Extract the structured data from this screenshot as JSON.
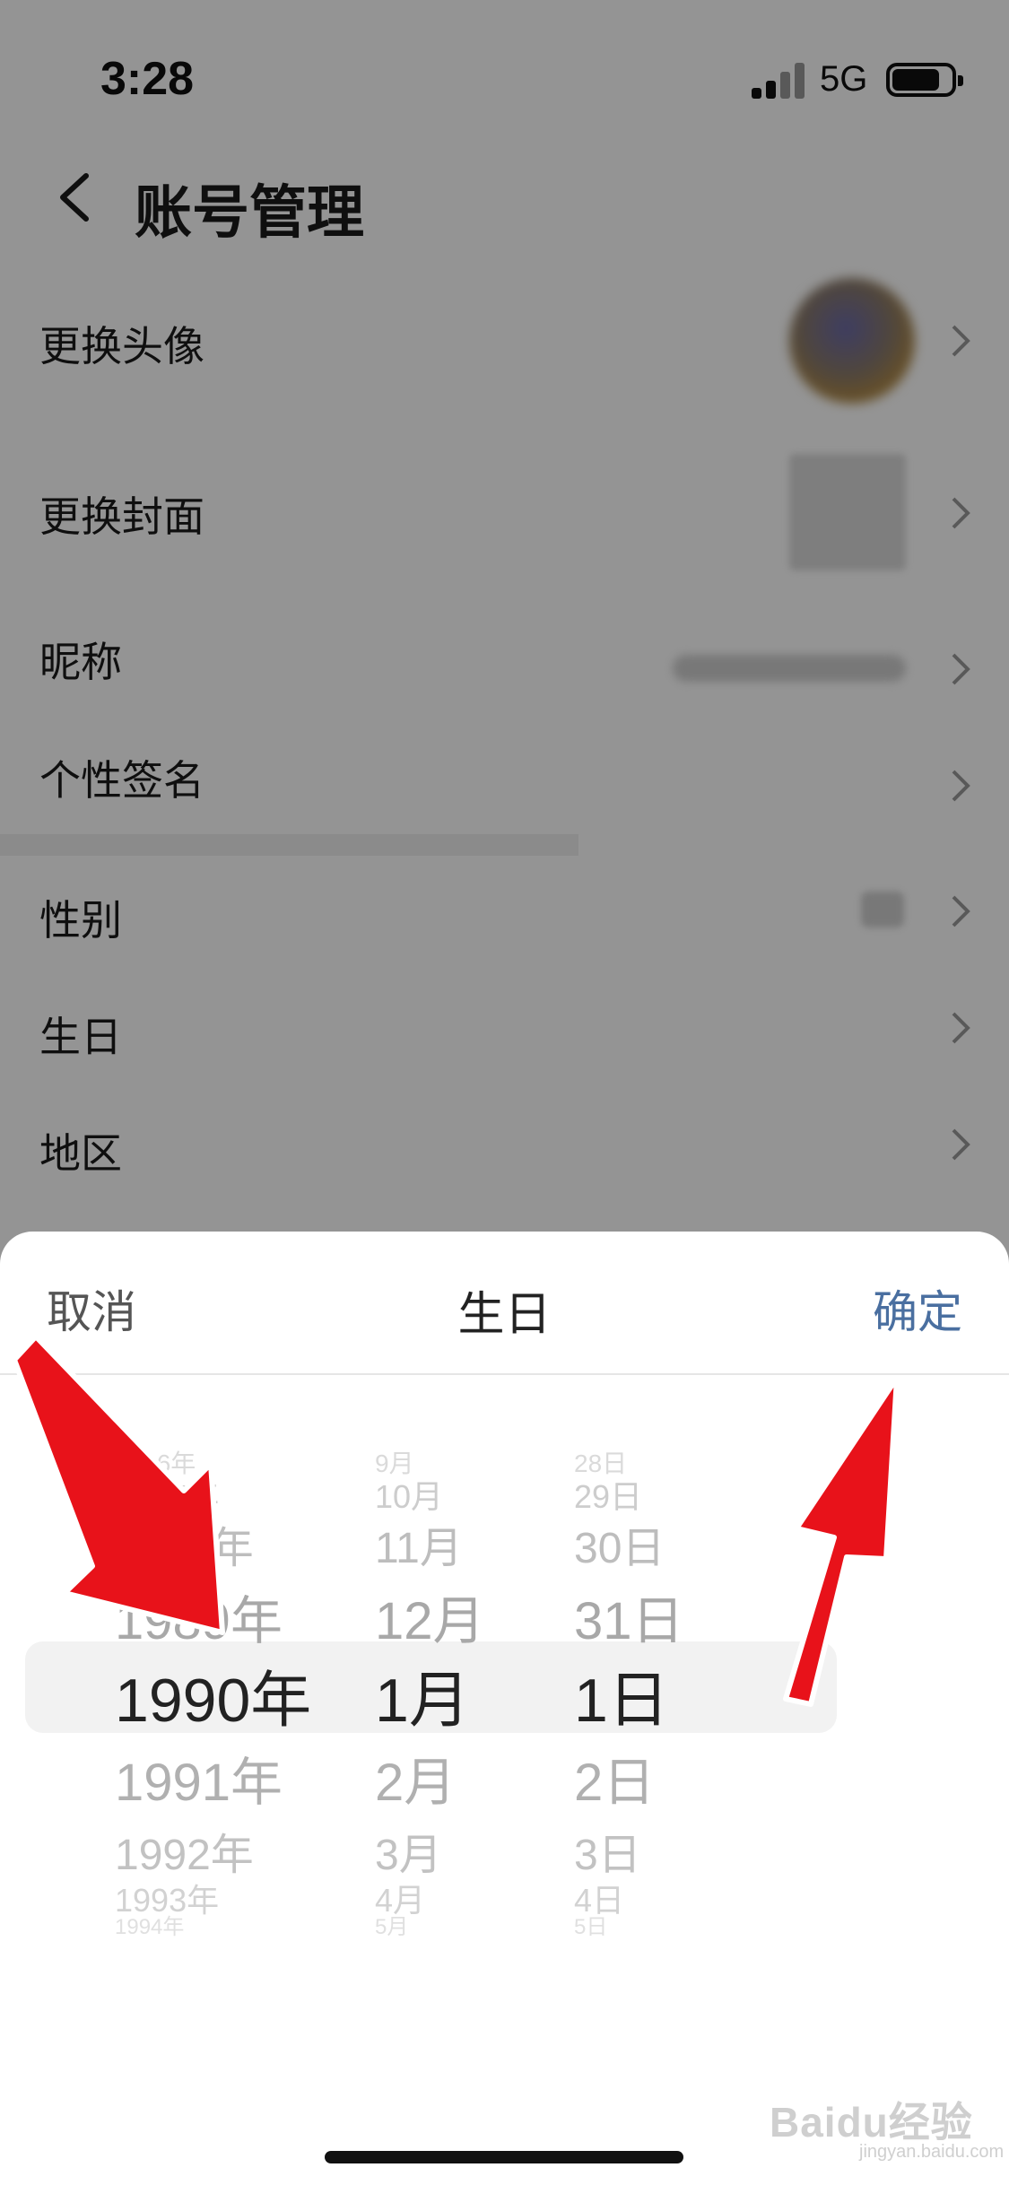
{
  "status_bar": {
    "time": "3:28",
    "network": "5G",
    "signal_icon": "cellular-signal-icon",
    "battery_icon": "battery-icon"
  },
  "nav": {
    "title": "账号管理",
    "back_icon": "chevron-left-icon"
  },
  "settings": {
    "avatar_label": "更换头像",
    "cover_label": "更换封面",
    "nickname_label": "昵称",
    "signature_label": "个性签名",
    "gender_label": "性别",
    "birthday_label": "生日",
    "region_label": "地区"
  },
  "sheet": {
    "cancel": "取消",
    "title": "生日",
    "confirm": "确定"
  },
  "picker": {
    "years": [
      "1986年",
      "1987年",
      "1988年",
      "1989年",
      "1990年",
      "1991年",
      "1992年",
      "1993年",
      "1994年"
    ],
    "months": [
      "9月",
      "10月",
      "11月",
      "12月",
      "1月",
      "2月",
      "3月",
      "4月",
      "5月"
    ],
    "days": [
      "28日",
      "29日",
      "30日",
      "31日",
      "1日",
      "2日",
      "3日",
      "4日",
      "5日"
    ],
    "selected": {
      "year": "1990年",
      "month": "1月",
      "day": "1日"
    }
  },
  "watermark": {
    "brand": "Baidu经验",
    "url": "jingyan.baidu.com"
  },
  "colors": {
    "accent": "#4a6fa0",
    "annotation_arrow": "#e8121a"
  }
}
